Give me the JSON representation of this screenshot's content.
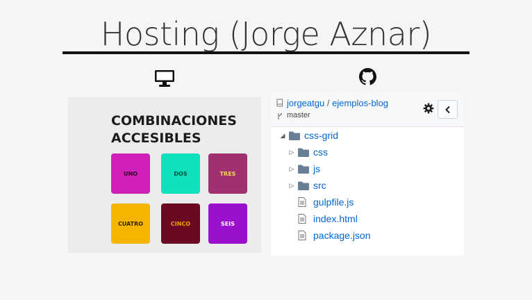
{
  "slide": {
    "title": "Hosting (Jorge Aznar)"
  },
  "icons": {
    "left": "monitor-icon",
    "right": "github-icon"
  },
  "left_panel": {
    "title": "COMBINACIONES ACCESIBLES",
    "tiles": [
      {
        "label": "UNO",
        "bg": "#d020b8",
        "fg": "#2a0a28"
      },
      {
        "label": "DOS",
        "bg": "#10e0bc",
        "fg": "#0b4c40"
      },
      {
        "label": "TRES",
        "bg": "#a03070",
        "fg": "#f0d860"
      },
      {
        "label": "CUATRO",
        "bg": "#f4b400",
        "fg": "#3a2400"
      },
      {
        "label": "CINCO",
        "bg": "#6a0a22",
        "fg": "#f4a000"
      },
      {
        "label": "SEIS",
        "bg": "#9a10cc",
        "fg": "#ffffff"
      }
    ]
  },
  "repo": {
    "owner": "jorgeatgu",
    "separator": "/",
    "name": "ejemplos-blog",
    "branch": "master",
    "tree": [
      {
        "label": "css-grid",
        "type": "folder",
        "expanded": true
      },
      {
        "label": "css",
        "type": "folder"
      },
      {
        "label": "js",
        "type": "folder"
      },
      {
        "label": "src",
        "type": "folder"
      },
      {
        "label": "gulpfile.js",
        "type": "file"
      },
      {
        "label": "index.html",
        "type": "file"
      },
      {
        "label": "package.json",
        "type": "file"
      }
    ]
  }
}
